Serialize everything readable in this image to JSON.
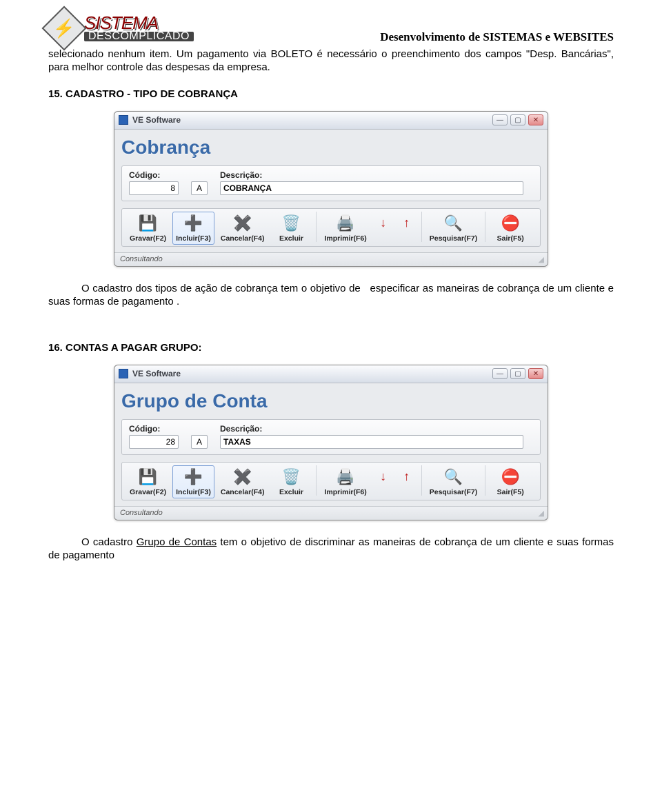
{
  "header": {
    "logo_line1": "SISTEMA",
    "logo_line2": "DESCOMPLICADO",
    "right_text": "Desenvolvimento de SISTEMAS e WEBSITES"
  },
  "para1": "selecionado nenhum item. Um pagamento via BOLETO é necessário o preenchimento dos campos \"Desp. Bancárias\", para melhor controle das despesas da empresa.",
  "heading15": "15. CADASTRO - TIPO DE COBRANÇA",
  "window1": {
    "app_title": "VE Software",
    "big_title": "Cobrança",
    "codigo_label": "Código:",
    "codigo_value": "8",
    "letter_value": "A",
    "desc_label": "Descrição:",
    "desc_value": "COBRANÇA",
    "status": "Consultando"
  },
  "toolbar": {
    "gravar": "Gravar(F2)",
    "incluir": "Incluir(F3)",
    "cancelar": "Cancelar(F4)",
    "excluir": "Excluir",
    "imprimir": "Imprimir(F6)",
    "pesquisar": "Pesquisar(F7)",
    "sair": "Sair(F5)"
  },
  "icons": {
    "gravar": "💾",
    "incluir": "➕",
    "cancelar": "✖️",
    "excluir": "🗑️",
    "imprimir": "🖨️",
    "down": "↓",
    "up": "↑",
    "pesquisar": "🔍",
    "sair": "⛔"
  },
  "para2_lead_space": "",
  "para2_pre": "O cadastro dos tipos de ação de cobrança tem o objetivo de ",
  "para2_bold": "",
  "para2_post": "especificar as maneiras de cobrança de um cliente e suas formas de pagamento .",
  "heading16": "16. CONTAS A PAGAR GRUPO:",
  "window2": {
    "app_title": "VE Software",
    "big_title": "Grupo de Conta",
    "codigo_label": "Código:",
    "codigo_value": "28",
    "letter_value": "A",
    "desc_label": "Descrição:",
    "desc_value": "TAXAS",
    "status": "Consultando"
  },
  "para3_pre": "O cadastro ",
  "para3_underline": "Grupo de Contas",
  "para3_mid": " tem o objetivo de  discriminar as maneiras de cobrança de um cliente e suas formas de pagamento"
}
